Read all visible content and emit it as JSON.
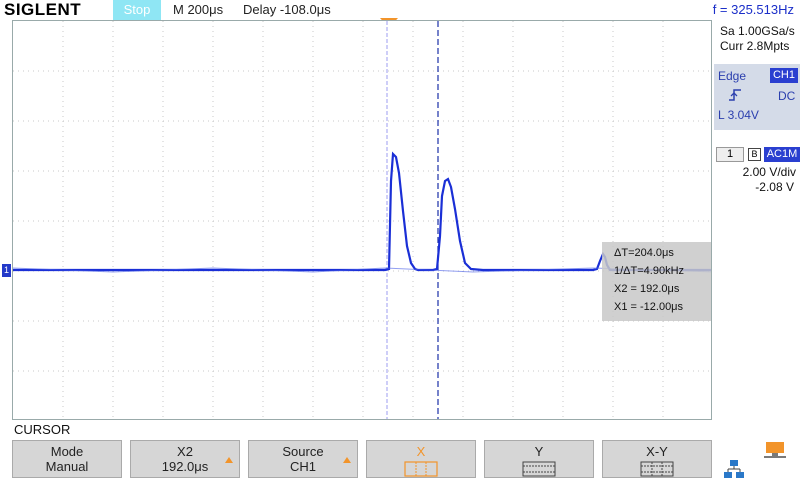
{
  "header": {
    "brand": "SIGLENT",
    "run_state": "Stop",
    "timebase": "M 200μs",
    "delay": "Delay -108.0μs",
    "frequency": "f = 325.513Hz"
  },
  "acquisition": {
    "sample_rate": "Sa 1.00GSa/s",
    "memory_depth": "Curr 2.8Mpts"
  },
  "trigger": {
    "type": "Edge",
    "source": "CH1",
    "coupling": "DC",
    "level": "L  3.04V"
  },
  "channel1": {
    "number": "1",
    "bandwidth_icon": "B",
    "coupling": "AC1M",
    "scale": "2.00 V/div",
    "offset": "-2.08 V",
    "marker": "1"
  },
  "cursor_readout": {
    "delta_t": "ΔT=204.0μs",
    "inv_delta_t": "1/ΔT=4.90kHz",
    "x2": "X2 = 192.0μs",
    "x1": "X1 = -12.00μs"
  },
  "menu": {
    "title": "CURSOR",
    "keys": [
      {
        "line1": "Mode",
        "line2": "Manual"
      },
      {
        "line1": "X2",
        "line2": "192.0μs"
      },
      {
        "line1": "Source",
        "line2": "CH1"
      },
      {
        "line1": "X",
        "line2": ""
      },
      {
        "line1": "Y",
        "line2": ""
      },
      {
        "line1": "X-Y",
        "line2": ""
      }
    ]
  },
  "colors": {
    "waveform": "#1a2fd6",
    "accent": "#f2942a",
    "stop_badge": "#8fe6f4",
    "trigger_panel": "#d4dbe8",
    "badge_blue": "#2a3fd0"
  },
  "icons": {
    "trigger_position": "orange-down-triangle-icon",
    "trigger_level": "blue-left-triangle-icon",
    "slope": "rising-edge-icon",
    "usb": "usb-drive-icon",
    "network": "network-icon"
  }
}
